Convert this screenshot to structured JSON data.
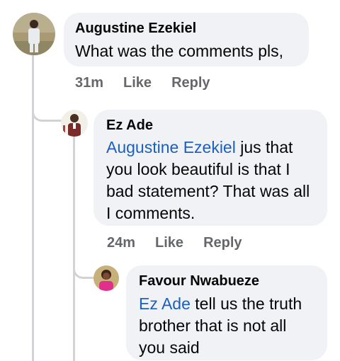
{
  "comments": [
    {
      "author": "Augustine Ezekiel",
      "text": "What was the comments pls,",
      "time": "31m",
      "like": "Like",
      "reply": "Reply"
    },
    {
      "author": "Ez Ade",
      "mention": "Augustine Ezekiel",
      "text": " jus that you look beautiful is that I bad statement? That was all I comments.",
      "time": "24m",
      "like": "Like",
      "reply": "Reply"
    },
    {
      "author": "Favour Nwabueze",
      "mention": "Ez Ade",
      "text": " tell us the truth brother that is not all you said"
    }
  ],
  "colors": {
    "bubble": "#f0f2f5",
    "mention": "#1b5fbf",
    "meta": "#65676b",
    "thread_line": "#d0d3d8"
  }
}
